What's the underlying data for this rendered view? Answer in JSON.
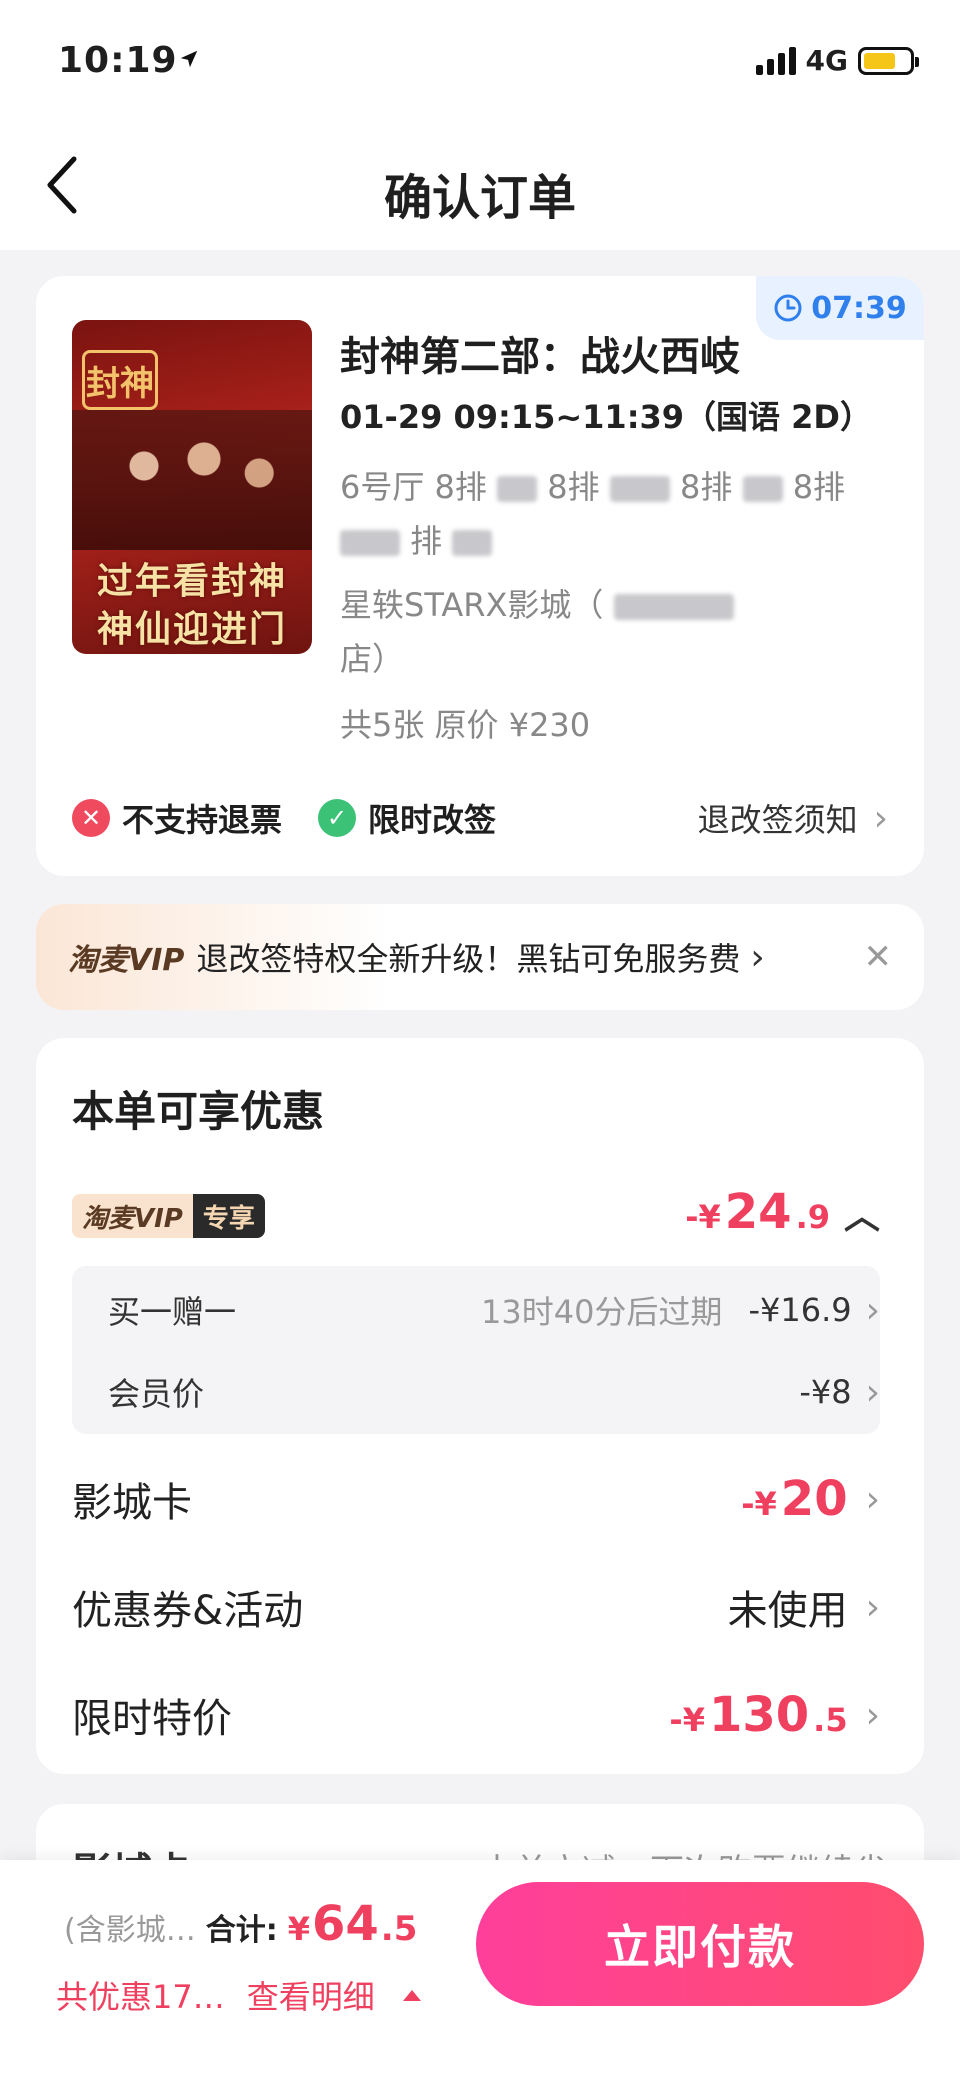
{
  "status_bar": {
    "time": "10:19",
    "network": "4G"
  },
  "nav": {
    "title": "确认订单"
  },
  "order": {
    "timer": "07:39",
    "poster": {
      "logo_text": "封神",
      "line1": "过年看封神",
      "line2": "神仙迎进门"
    },
    "movie_title": "封神第二部：战火西岐",
    "showtime": "01-29 09:15~11:39（国语 2D）",
    "seats_prefix": "6号厅 8排",
    "seat_frag_2": "8排",
    "seat_frag_3": "8排",
    "seat_frag_4": "8排",
    "seat_frag_5": "排",
    "cinema_text": "星轶STARX影城（",
    "cinema_tail": "店）",
    "price_line": "共5张 原价 ¥230",
    "no_refund": "不支持退票",
    "limited_change": "限时改签",
    "policy_link": "退改签须知"
  },
  "vip_banner": {
    "logo": "淘麦VIP",
    "text": "退改签特权全新升级！黑钻可免服务费"
  },
  "discounts": {
    "title": "本单可享优惠",
    "vip_tag_a": "淘麦VIP",
    "vip_tag_b": "专享",
    "vip_amount_minus": "-¥",
    "vip_amount_int": "24",
    "vip_amount_dec": ".9",
    "bogo_label": "买一赠一",
    "bogo_note": "13时40分后过期",
    "bogo_value": "-¥16.9",
    "member_label": "会员价",
    "member_value": "-¥8",
    "cinema_card_label": "影城卡",
    "cinema_card_minus": "-¥",
    "cinema_card_value": "20",
    "coupon_label": "优惠券&活动",
    "coupon_value": "未使用",
    "special_label": "限时特价",
    "special_minus": "-¥",
    "special_int": "130",
    "special_dec": ".5"
  },
  "peek": {
    "left": "影城卡",
    "right": "本单立减，下次购票继续省"
  },
  "bottom": {
    "included": "(含影城…",
    "total_label": "合计:",
    "total_cur": "¥",
    "total_int": "64",
    "total_dec": ".5",
    "saved": "共优惠17…",
    "details": "查看明细",
    "pay_button": "立即付款"
  },
  "colors": {
    "accent_red": "#f04060",
    "timer_blue": "#2f80ed",
    "pay_gradient_start": "#ff3f9b",
    "pay_gradient_end": "#ff4d6d"
  }
}
